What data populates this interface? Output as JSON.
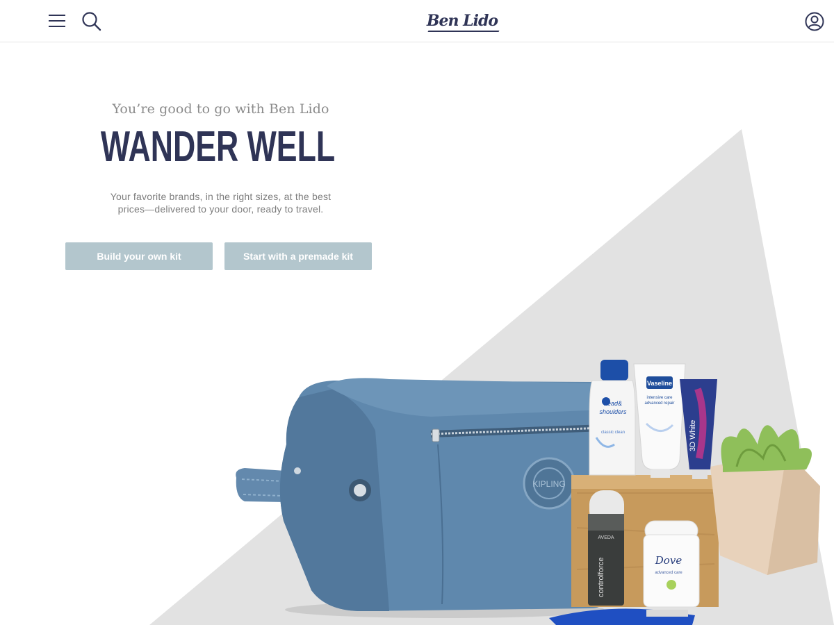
{
  "header": {
    "logo_text": "Ben Lido",
    "menu_icon": "hamburger-menu-icon",
    "search_icon": "search-icon",
    "account_icon": "user-account-icon"
  },
  "hero": {
    "eyebrow": "You’re good to go with Ben Lido",
    "headline": "WANDER WELL",
    "subtext": "Your favorite brands, in the right sizes, at the best prices—delivered to your door, ready to travel.",
    "buttons": {
      "build": "Build your own kit",
      "premade": "Start with a premade kit"
    }
  },
  "product_labels": {
    "shampoo_line1": "head&",
    "shampoo_line2": "shoulders",
    "shampoo_variant": "classic clean",
    "lotion_brand": "Vaseline",
    "lotion_line1": "intensive care",
    "lotion_line2": "advanced repair",
    "toothpaste": "3D White",
    "hairspray_brand": "AVEDA",
    "hairspray_name": "controlforce",
    "deodorant_brand": "Dove",
    "deodorant_name": "advanced care",
    "bag_badge": "KIPLING"
  },
  "colors": {
    "brand_navy": "#2f3456",
    "button_bg": "#b3c6cd",
    "triangle_gray": "#e2e2e2",
    "bag_blue": "#5f88ad"
  }
}
